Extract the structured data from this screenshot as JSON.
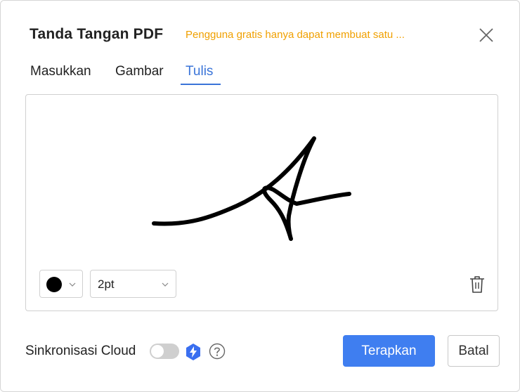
{
  "dialog": {
    "title": "Tanda Tangan PDF",
    "notice": "Pengguna gratis hanya dapat membuat satu ...",
    "close_icon": "close-icon"
  },
  "tabs": [
    {
      "label": "Masukkan",
      "active": false
    },
    {
      "label": "Gambar",
      "active": false
    },
    {
      "label": "Tulis",
      "active": true
    }
  ],
  "canvas": {
    "pen_color": "#000000",
    "pen_size": "2pt",
    "clear_icon": "trash-icon"
  },
  "footer": {
    "cloud_sync_label": "Sinkronisasi Cloud",
    "cloud_sync_enabled": false,
    "premium_icon": "bolt-icon",
    "help_icon": "question-icon",
    "apply_label": "Terapkan",
    "cancel_label": "Batal"
  },
  "colors": {
    "accent": "#3f7ef0",
    "tab_active": "#3a74d8",
    "notice": "#f0a000"
  }
}
